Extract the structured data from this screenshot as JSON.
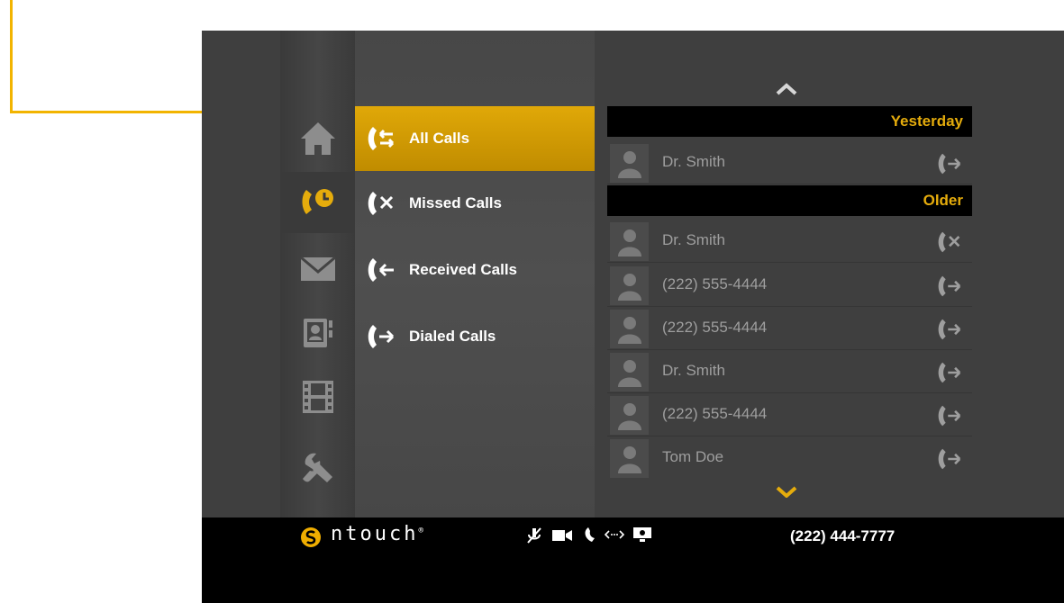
{
  "nav": {
    "items": [
      {
        "name": "home",
        "icon": "home-icon",
        "active": false
      },
      {
        "name": "call-history",
        "icon": "call-history-icon",
        "active": true
      },
      {
        "name": "messages",
        "icon": "envelope-icon",
        "active": false
      },
      {
        "name": "contacts",
        "icon": "contact-book-icon",
        "active": false
      },
      {
        "name": "videos",
        "icon": "film-icon",
        "active": false
      },
      {
        "name": "settings",
        "icon": "wrench-icon",
        "active": false
      }
    ]
  },
  "menu": {
    "items": [
      {
        "label": "All Calls",
        "icon": "all-calls-icon",
        "active": true
      },
      {
        "label": "Missed Calls",
        "icon": "missed-call-icon",
        "active": false
      },
      {
        "label": "Received Calls",
        "icon": "received-call-icon",
        "active": false
      },
      {
        "label": "Dialed Calls",
        "icon": "dialed-call-icon",
        "active": false
      }
    ]
  },
  "calls": {
    "groups": [
      {
        "header": "Yesterday",
        "entries": [
          {
            "name": "Dr. Smith",
            "type": "dialed"
          }
        ]
      },
      {
        "header": "Older",
        "entries": [
          {
            "name": "Dr. Smith",
            "type": "missed"
          },
          {
            "name": "(222) 555-4444",
            "type": "dialed"
          },
          {
            "name": "(222) 555-4444",
            "type": "dialed"
          },
          {
            "name": "Dr. Smith",
            "type": "dialed"
          },
          {
            "name": "(222) 555-4444",
            "type": "dialed"
          },
          {
            "name": "Tom Doe",
            "type": "dialed"
          }
        ]
      }
    ]
  },
  "statusbar": {
    "brand": "ntouch",
    "brand_mark": "®",
    "own_number": "(222) 444-7777",
    "icons": [
      "mic-muted-icon",
      "video-camera-icon",
      "phone-icon",
      "network-icon",
      "screen-share-icon"
    ]
  },
  "colors": {
    "accent": "#e5ac0c",
    "annotation": "#f2b400"
  }
}
